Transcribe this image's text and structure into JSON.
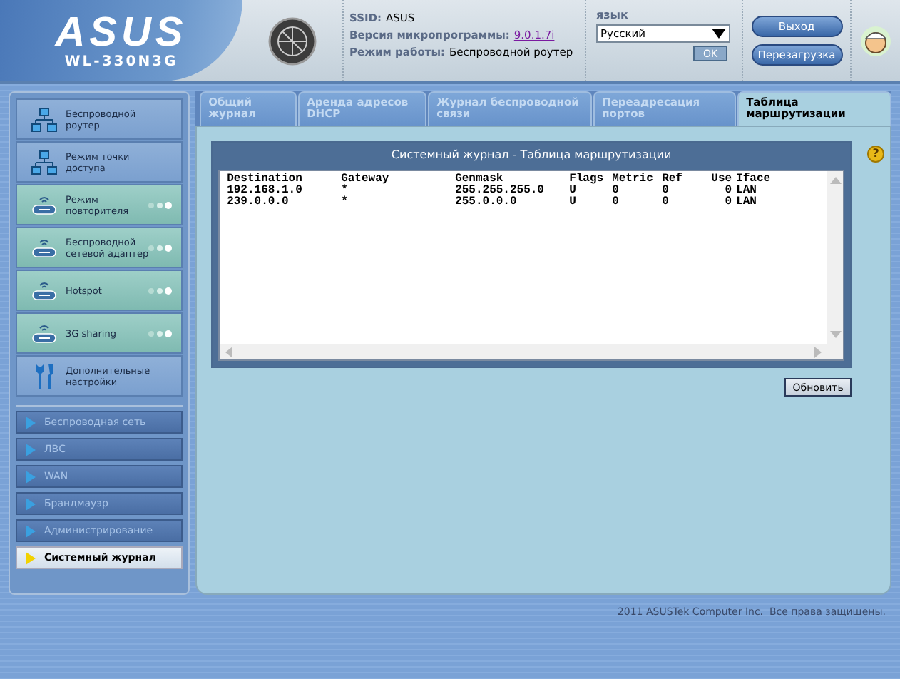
{
  "header": {
    "logo": "ASUS",
    "model": "WL-330N3G",
    "info": [
      {
        "label": "SSID:",
        "value": "ASUS",
        "kind": "text"
      },
      {
        "label": "Версия микропрограммы:",
        "value": "9.0.1.7i",
        "kind": "link"
      },
      {
        "label": "Режим работы:",
        "value": "Беспроводной роутер",
        "kind": "text"
      }
    ],
    "language": {
      "label": "язык",
      "value": "Русский",
      "button": "OK"
    },
    "buttons": [
      "Выход",
      "Перезагрузка"
    ]
  },
  "sidebar": {
    "items": [
      {
        "label": "Беспроводной роутер",
        "kind": "wired"
      },
      {
        "label": "Режим точки доступа",
        "kind": "wired"
      },
      {
        "label": "Режим повторителя",
        "kind": "wireless"
      },
      {
        "label": "Беспроводной сетевой адаптер",
        "kind": "wireless"
      },
      {
        "label": "Hotspot",
        "kind": "wireless"
      },
      {
        "label": "3G sharing",
        "kind": "wireless"
      },
      {
        "label": "Дополнительные настройки",
        "kind": "settings"
      }
    ],
    "submenu": [
      {
        "label": "Беспроводная сеть",
        "selected": false
      },
      {
        "label": "ЛВС",
        "selected": false
      },
      {
        "label": "WAN",
        "selected": false
      },
      {
        "label": "Брандмауэр",
        "selected": false
      },
      {
        "label": "Администрирование",
        "selected": false
      },
      {
        "label": "Системный журнал",
        "selected": true
      }
    ]
  },
  "tabs": [
    {
      "label": "Общий журнал",
      "selected": false
    },
    {
      "label": "Аренда адресов DHCP",
      "selected": false
    },
    {
      "label": "Журнал беспроводной связи",
      "selected": false
    },
    {
      "label": "Переадресация портов",
      "selected": false
    },
    {
      "label": "Таблица маршрутизации",
      "selected": true
    }
  ],
  "panel": {
    "title": "Системный журнал - Таблица маршрутизации",
    "help": "?",
    "table": {
      "columns": [
        "Destination",
        "Gateway",
        "Genmask",
        "Flags",
        "Metric",
        "Ref",
        "Use",
        "Iface"
      ],
      "rows": [
        [
          "192.168.1.0",
          "*",
          "255.255.255.0",
          "U",
          "0",
          "0",
          "0",
          "LAN"
        ],
        [
          "239.0.0.0",
          "*",
          "255.0.0.0",
          "U",
          "0",
          "0",
          "0",
          "LAN"
        ]
      ]
    },
    "button": "Обновить"
  },
  "footer": "2011 ASUSTek Computer Inc.  Все права защищены."
}
